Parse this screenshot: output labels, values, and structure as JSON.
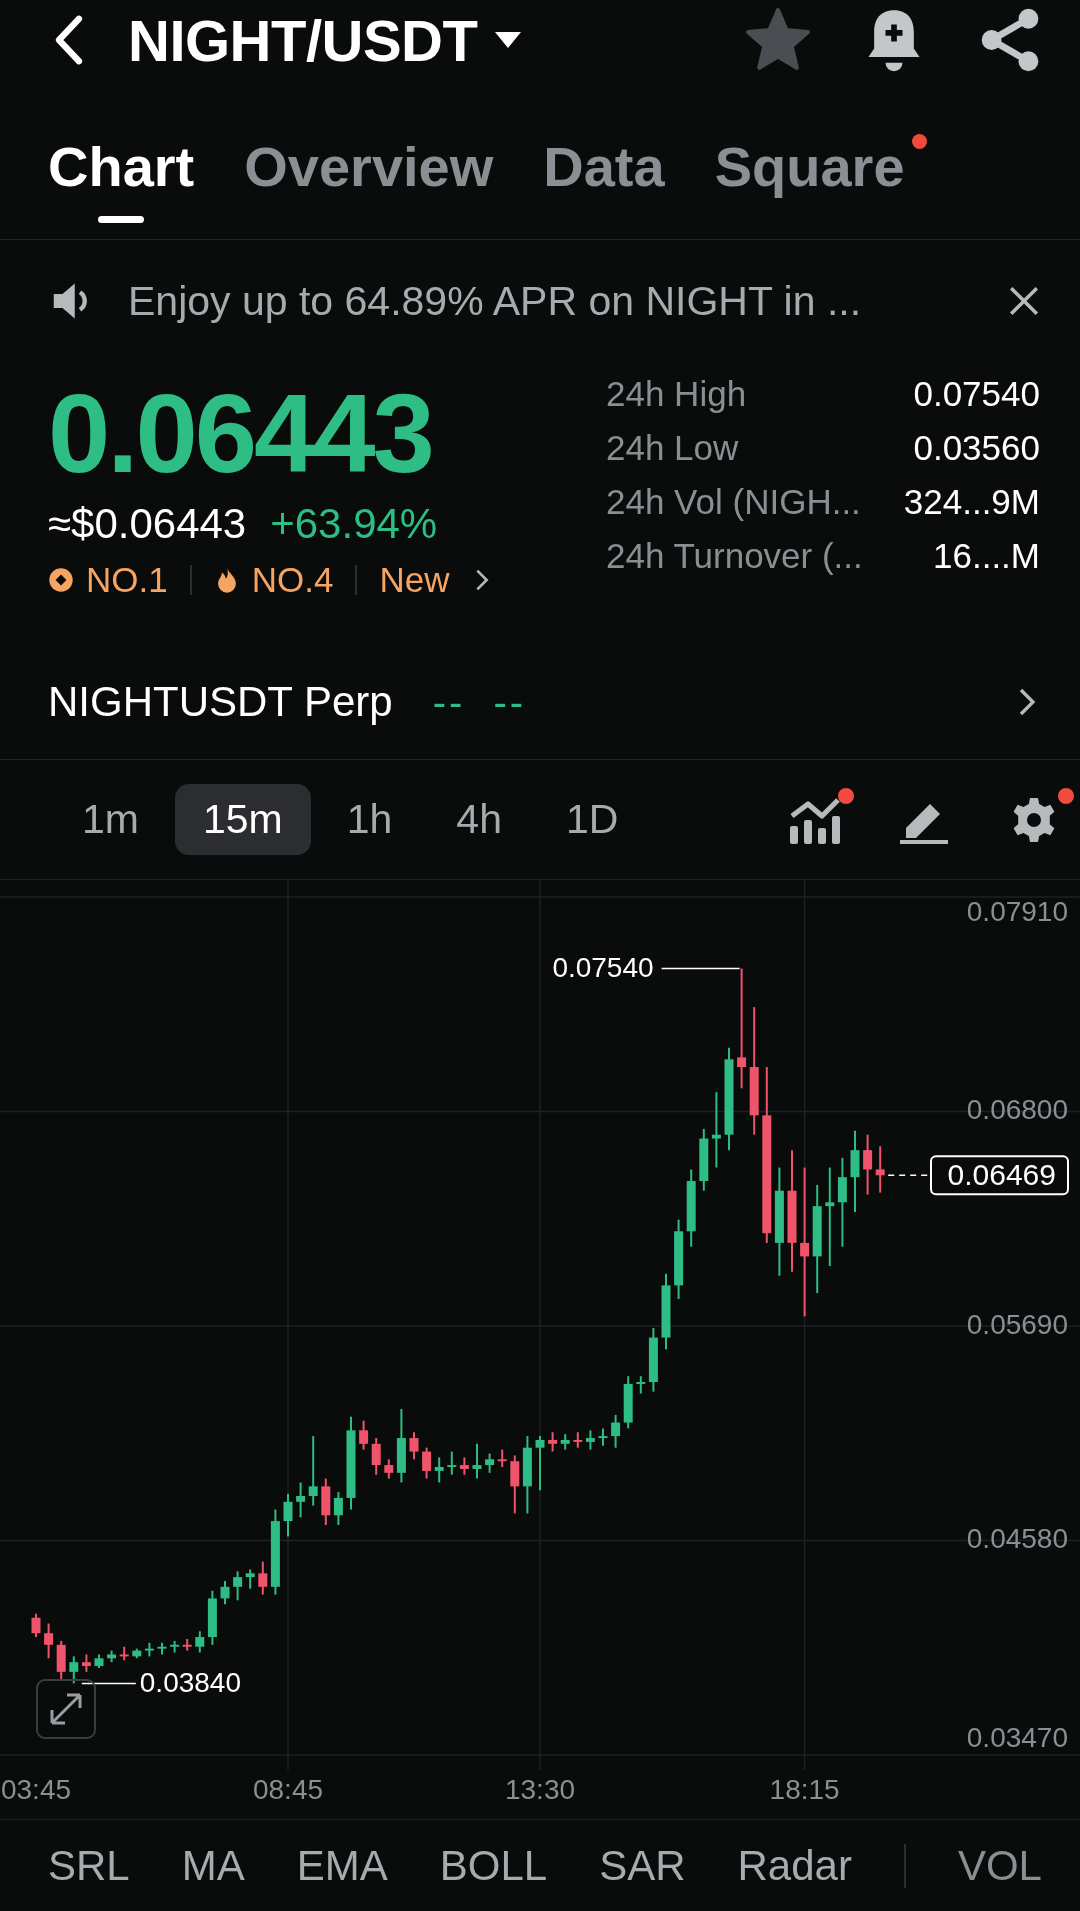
{
  "header": {
    "title": "NIGHT/USDT"
  },
  "tabs": [
    {
      "label": "Chart",
      "selected": true,
      "dot": false
    },
    {
      "label": "Overview",
      "selected": false,
      "dot": false
    },
    {
      "label": "Data",
      "selected": false,
      "dot": false
    },
    {
      "label": "Square",
      "selected": false,
      "dot": true
    }
  ],
  "banner": {
    "text": "Enjoy up to 64.89% APR on NIGHT in ..."
  },
  "price": {
    "last": "0.06443",
    "usd": "≈$0.06443",
    "change": "+63.94%"
  },
  "badges": [
    {
      "kind": "rank",
      "label": "NO.1"
    },
    {
      "kind": "hot",
      "label": "NO.4"
    },
    {
      "kind": "plain",
      "label": "New"
    }
  ],
  "stats": [
    {
      "label": "24h High",
      "value": "0.07540"
    },
    {
      "label": "24h Low",
      "value": "0.03560"
    },
    {
      "label": "24h Vol (NIGH...",
      "value": "324...9M"
    },
    {
      "label": "24h Turnover (...",
      "value": "16....M"
    }
  ],
  "perp": {
    "label": "NIGHTUSDT Perp",
    "value": "--  --"
  },
  "timeframes": [
    {
      "label": "1m",
      "selected": false
    },
    {
      "label": "15m",
      "selected": true
    },
    {
      "label": "1h",
      "selected": false
    },
    {
      "label": "4h",
      "selected": false
    },
    {
      "label": "1D",
      "selected": false
    }
  ],
  "tools": [
    {
      "kind": "indicators",
      "dot": true
    },
    {
      "kind": "draw",
      "dot": false
    },
    {
      "kind": "settings",
      "dot": true
    }
  ],
  "chart_data": {
    "type": "candlestick",
    "grid": true,
    "ylim": [
      0.03392,
      0.07998
    ],
    "yticks": [
      {
        "value": 0.0791,
        "label": "0.07910"
      },
      {
        "value": 0.068,
        "label": "0.06800"
      },
      {
        "value": 0.0569,
        "label": "0.05690"
      },
      {
        "value": 0.0458,
        "label": "0.04580"
      },
      {
        "value": 0.0347,
        "label": "0.03470"
      }
    ],
    "categories": [
      "03:45",
      null,
      null,
      null,
      null,
      null,
      null,
      null,
      null,
      null,
      null,
      null,
      null,
      null,
      null,
      null,
      null,
      null,
      null,
      null,
      "08:45",
      null,
      null,
      null,
      null,
      null,
      null,
      null,
      null,
      null,
      null,
      null,
      null,
      null,
      null,
      null,
      null,
      null,
      null,
      null,
      "13:30",
      null,
      null,
      null,
      null,
      null,
      null,
      null,
      null,
      null,
      null,
      null,
      null,
      null,
      null,
      null,
      null,
      null,
      null,
      null,
      null,
      "18:15",
      null,
      null,
      null,
      null,
      null,
      null
    ],
    "ohlc": [
      [
        0.0418,
        0.042,
        0.0408,
        0.041
      ],
      [
        0.041,
        0.0415,
        0.0397,
        0.0404
      ],
      [
        0.0404,
        0.0406,
        0.0386,
        0.039
      ],
      [
        0.039,
        0.0398,
        0.0384,
        0.0395
      ],
      [
        0.0395,
        0.0399,
        0.039,
        0.0393
      ],
      [
        0.0393,
        0.0399,
        0.0392,
        0.0397
      ],
      [
        0.0397,
        0.0401,
        0.0395,
        0.0399
      ],
      [
        0.0399,
        0.0403,
        0.0396,
        0.0398
      ],
      [
        0.0398,
        0.0402,
        0.0397,
        0.0401
      ],
      [
        0.0401,
        0.0405,
        0.0398,
        0.0402
      ],
      [
        0.0402,
        0.0405,
        0.0399,
        0.0403
      ],
      [
        0.0403,
        0.0406,
        0.04,
        0.0404
      ],
      [
        0.0404,
        0.0407,
        0.0401,
        0.0403
      ],
      [
        0.0403,
        0.0411,
        0.04,
        0.0408
      ],
      [
        0.0408,
        0.0432,
        0.0404,
        0.0428
      ],
      [
        0.0428,
        0.0437,
        0.0425,
        0.0434
      ],
      [
        0.0434,
        0.0442,
        0.0427,
        0.0439
      ],
      [
        0.0439,
        0.0443,
        0.0433,
        0.0441
      ],
      [
        0.0441,
        0.0447,
        0.043,
        0.0434
      ],
      [
        0.0434,
        0.0474,
        0.043,
        0.0468
      ],
      [
        0.0468,
        0.0482,
        0.046,
        0.0478
      ],
      [
        0.0478,
        0.0488,
        0.047,
        0.0481
      ],
      [
        0.0481,
        0.0512,
        0.0476,
        0.0486
      ],
      [
        0.0486,
        0.049,
        0.0466,
        0.0471
      ],
      [
        0.0471,
        0.0483,
        0.0466,
        0.048
      ],
      [
        0.048,
        0.0522,
        0.0474,
        0.0515
      ],
      [
        0.0515,
        0.052,
        0.0505,
        0.0508
      ],
      [
        0.0508,
        0.0511,
        0.0492,
        0.0497
      ],
      [
        0.0497,
        0.05,
        0.049,
        0.0493
      ],
      [
        0.0493,
        0.0526,
        0.0488,
        0.0511
      ],
      [
        0.0511,
        0.0514,
        0.05,
        0.0504
      ],
      [
        0.0504,
        0.0506,
        0.049,
        0.0494
      ],
      [
        0.0494,
        0.0501,
        0.0488,
        0.0496
      ],
      [
        0.0496,
        0.0504,
        0.0492,
        0.0497
      ],
      [
        0.0497,
        0.0501,
        0.0492,
        0.0495
      ],
      [
        0.0495,
        0.0508,
        0.049,
        0.0497
      ],
      [
        0.0497,
        0.0503,
        0.0493,
        0.05
      ],
      [
        0.05,
        0.0505,
        0.0496,
        0.0499
      ],
      [
        0.0499,
        0.0502,
        0.0472,
        0.0486
      ],
      [
        0.0486,
        0.0512,
        0.0472,
        0.0506
      ],
      [
        0.0506,
        0.0512,
        0.0484,
        0.051
      ],
      [
        0.051,
        0.0514,
        0.0504,
        0.0508
      ],
      [
        0.0508,
        0.0513,
        0.0505,
        0.051
      ],
      [
        0.051,
        0.0514,
        0.0506,
        0.0509
      ],
      [
        0.0509,
        0.0515,
        0.0505,
        0.0511
      ],
      [
        0.0511,
        0.0516,
        0.0507,
        0.0512
      ],
      [
        0.0512,
        0.0523,
        0.0506,
        0.0519
      ],
      [
        0.0519,
        0.0543,
        0.0516,
        0.0539
      ],
      [
        0.0539,
        0.0543,
        0.0534,
        0.054
      ],
      [
        0.054,
        0.0568,
        0.0535,
        0.0563
      ],
      [
        0.0563,
        0.0596,
        0.0557,
        0.059
      ],
      [
        0.059,
        0.0624,
        0.0583,
        0.0618
      ],
      [
        0.0618,
        0.065,
        0.061,
        0.0644
      ],
      [
        0.0644,
        0.0671,
        0.0639,
        0.0666
      ],
      [
        0.0666,
        0.069,
        0.0651,
        0.0668
      ],
      [
        0.0668,
        0.0713,
        0.066,
        0.0707
      ],
      [
        0.0708,
        0.0754,
        0.0692,
        0.0703
      ],
      [
        0.0703,
        0.0734,
        0.0668,
        0.0678
      ],
      [
        0.0678,
        0.0703,
        0.0612,
        0.0617
      ],
      [
        0.0612,
        0.0651,
        0.0595,
        0.0639
      ],
      [
        0.0639,
        0.066,
        0.0597,
        0.0612
      ],
      [
        0.0612,
        0.0651,
        0.0574,
        0.0605
      ],
      [
        0.0605,
        0.0642,
        0.0586,
        0.0631
      ],
      [
        0.0631,
        0.0651,
        0.06,
        0.0633
      ],
      [
        0.0633,
        0.0656,
        0.061,
        0.0646
      ],
      [
        0.0646,
        0.067,
        0.0628,
        0.066
      ],
      [
        0.066,
        0.0668,
        0.0637,
        0.065
      ],
      [
        0.065,
        0.0662,
        0.0638,
        0.0647
      ]
    ]
  },
  "chart_labels": {
    "high_label": "0.07540",
    "low_label": "0.03840",
    "last_label": "0.06469"
  },
  "indicators": [
    {
      "label": "SRL",
      "separator": false
    },
    {
      "label": "MA",
      "separator": false
    },
    {
      "label": "EMA",
      "separator": false
    },
    {
      "label": "BOLL",
      "separator": false
    },
    {
      "label": "SAR",
      "separator": false
    },
    {
      "label": "Radar",
      "separator": false
    },
    {
      "label": "VOL",
      "separator": true
    }
  ]
}
